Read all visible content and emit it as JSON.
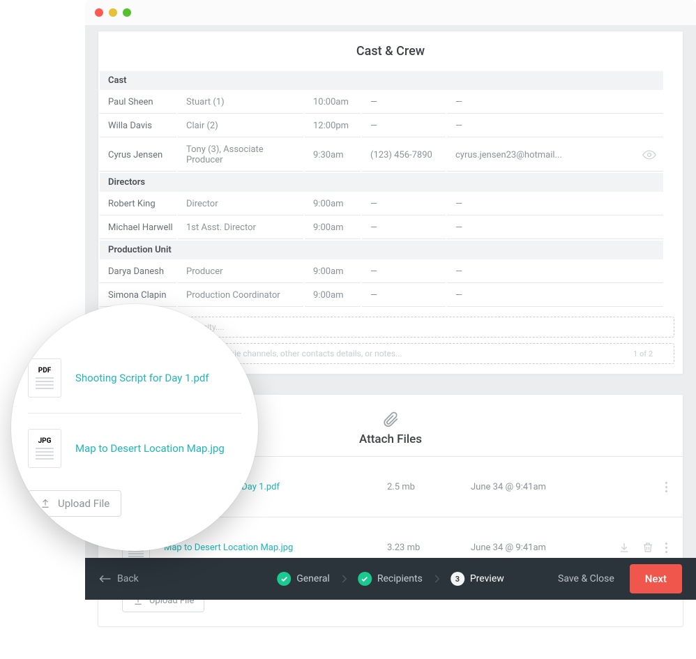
{
  "section_title": "Cast & Crew",
  "groups": [
    {
      "label": "Cast",
      "rows": [
        {
          "name": "Paul Sheen",
          "role": "Stuart (1)",
          "time": "10:00am",
          "phone": "—",
          "email": "—",
          "eye": false
        },
        {
          "name": "Willa Davis",
          "role": "Clair (2)",
          "time": "12:00pm",
          "phone": "—",
          "email": "—",
          "eye": false
        },
        {
          "name": "Cyrus Jensen",
          "role": "Tony (3), Associate Producer",
          "time": "9:30am",
          "phone": "(123) 456-7890",
          "email": "cyrus.jensen23@hotmail...",
          "eye": true
        }
      ]
    },
    {
      "label": "Directors",
      "rows": [
        {
          "name": "Robert King",
          "role": "Director",
          "time": "9:00am",
          "phone": "—",
          "email": "—",
          "eye": false
        },
        {
          "name": "Michael Harwell",
          "role": "1st Asst. Director",
          "time": "9:00am",
          "phone": "—",
          "email": "—",
          "eye": false
        }
      ]
    },
    {
      "label": "Production Unit",
      "rows": [
        {
          "name": "Darya Danesh",
          "role": "Producer",
          "time": "9:00am",
          "phone": "—",
          "email": "—",
          "eye": false
        },
        {
          "name": "Simona Clapin",
          "role": "Production Coordinator",
          "time": "9:00am",
          "phone": "—",
          "email": "—",
          "eye": false
        }
      ]
    }
  ],
  "hospital_placeholder": "Search hospital by city....",
  "footer_placeholder": "Enter footer notes (i.e. walkie channels, other contacts details, or notes...",
  "page_indicator": "1 of 2",
  "attach": {
    "title": "Attach Files",
    "files": [
      {
        "ext": "PDF",
        "ext_class": "pdf",
        "name": "Shooting Script for Day 1.pdf",
        "size": "2.5 mb",
        "date": "June 34 @ 9:41am",
        "actions": false
      },
      {
        "ext": "JPG",
        "ext_class": "jpg",
        "name": "Map to Desert Location Map.jpg",
        "size": "3.23 mb",
        "date": "June 34 @ 9:41am",
        "actions": true
      }
    ],
    "upload_label": "Upload File"
  },
  "lens_files": [
    {
      "ext": "PDF",
      "ext_class": "pdf",
      "name": "Shooting Script for Day 1.pdf"
    },
    {
      "ext": "JPG",
      "ext_class": "jpg",
      "name": "Map to Desert Location Map.jpg"
    }
  ],
  "bottom": {
    "back": "Back",
    "steps": [
      {
        "label": "General",
        "state": "done"
      },
      {
        "label": "Recipients",
        "state": "done"
      },
      {
        "num": "3",
        "label": "Preview",
        "state": "active"
      }
    ],
    "save": "Save & Close",
    "next": "Next"
  }
}
